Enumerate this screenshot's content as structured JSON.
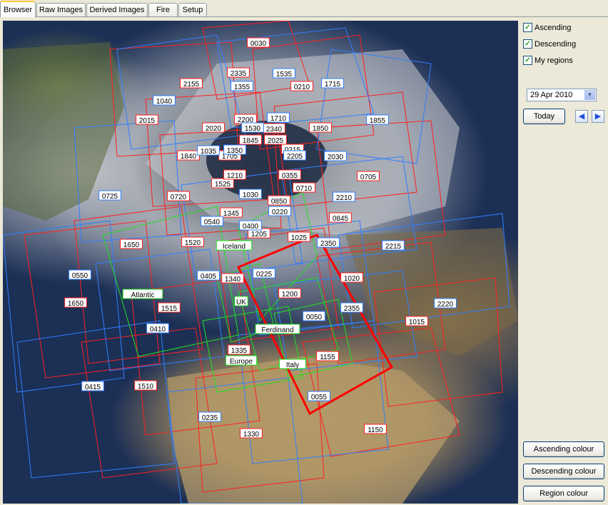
{
  "tabs": [
    {
      "label": "Browser",
      "active": true
    },
    {
      "label": "Raw Images",
      "active": false
    },
    {
      "label": "Derived Images",
      "active": false
    },
    {
      "label": "Fire",
      "active": false
    },
    {
      "label": "Setup",
      "active": false
    }
  ],
  "panel": {
    "ascending": {
      "label": "Ascending",
      "checked": true
    },
    "descending": {
      "label": "Descending",
      "checked": true
    },
    "my_regions": {
      "label": "My regions",
      "checked": true
    },
    "date": "29 Apr  2010",
    "today_label": "Today",
    "prev_icon": "left-arrow-icon",
    "next_icon": "right-arrow-icon",
    "ascending_colour_label": "Ascending colour",
    "descending_colour_label": "Descending colour",
    "region_colour_label": "Region colour"
  },
  "colors": {
    "ascending": "#ff2020",
    "descending": "#2f7fff",
    "region": "#20e020",
    "selected": "#ff0000"
  },
  "map": {
    "ascending_labels": [
      "0030",
      "2335",
      "2155",
      "0210",
      "2015",
      "2020",
      "2200",
      "2340",
      "1850",
      "1845",
      "2025",
      "1840",
      "1705",
      "0215",
      "0355",
      "1525",
      "1210",
      "0710",
      "0720",
      "0850",
      "1345",
      "0845",
      "1205",
      "1025",
      "1520",
      "1340",
      "1020",
      "1650",
      "1515",
      "1200",
      "1015",
      "1335",
      "1155",
      "1510",
      "1150",
      "1330",
      "1650",
      "0705"
    ],
    "descending_labels": [
      "1535",
      "1355",
      "1715",
      "1040",
      "1530",
      "1855",
      "1710",
      "1035",
      "1350",
      "2205",
      "2030",
      "0725",
      "1030",
      "0220",
      "2210",
      "0540",
      "0400",
      "0550",
      "0405",
      "0225",
      "2350",
      "2215",
      "0410",
      "0050",
      "2355",
      "2220",
      "0415",
      "0055",
      "0235"
    ],
    "region_labels": [
      "Iceland",
      "Atlantic",
      "UK",
      "Ferdinand",
      "Europe",
      "Italy"
    ]
  }
}
